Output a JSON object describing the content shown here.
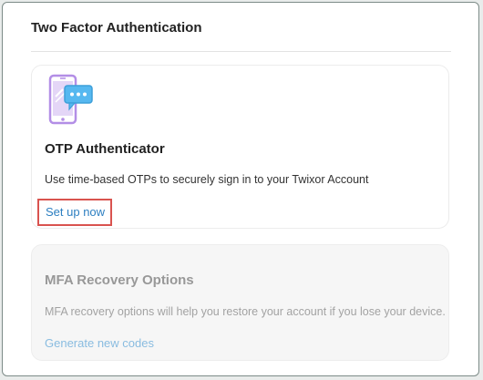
{
  "panel": {
    "title": "Two Factor Authentication"
  },
  "otp": {
    "icon": "phone-chat-icon",
    "title": "OTP Authenticator",
    "description": "Use time-based OTPs to securely sign in to your Twixor Account",
    "link_label": "Set up now"
  },
  "mfa": {
    "title": "MFA Recovery Options",
    "description": "MFA recovery options will help you restore your account if you lose your device.",
    "link_label": "Generate new codes"
  },
  "colors": {
    "link": "#2d7fc1",
    "link_disabled": "#7db5dd",
    "highlight_border": "#d9534f",
    "icon_purple": "#b38ee6",
    "icon_blue": "#56b8f0"
  }
}
